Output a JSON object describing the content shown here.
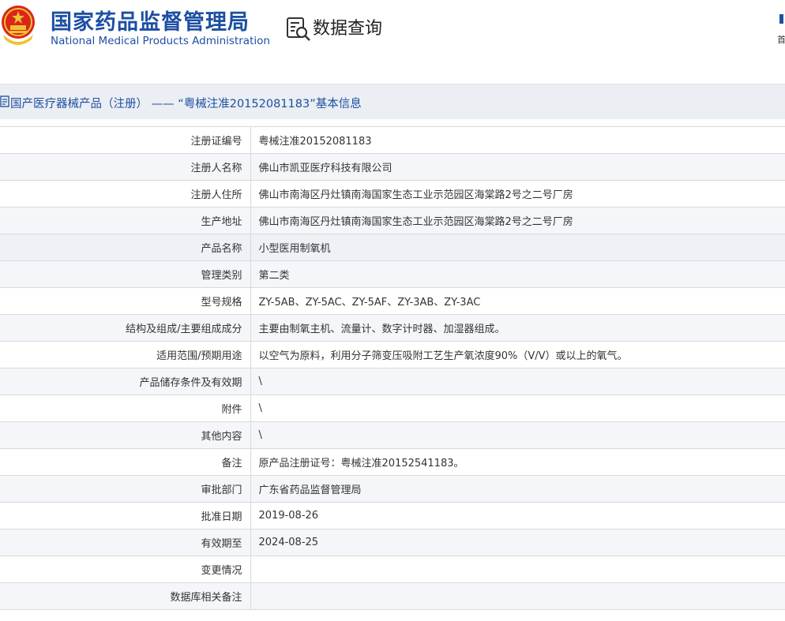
{
  "header": {
    "site_title_cn": "国家药品监督管理局",
    "site_title_en": "National Medical Products Administration",
    "query_title": "数据查询",
    "home_label": "首页",
    "brand_color": "#1d4fa3",
    "emblem_icon": "national-emblem-icon",
    "query_icon": "data-query-icon",
    "home_icon": "home-icon"
  },
  "section": {
    "title": "国产医疗器械产品（注册） —— “粤械注准20152081183”基本信息",
    "icon": "document-icon"
  },
  "table": {
    "rows": [
      {
        "label": "注册证编号",
        "value": "粤械注准20152081183"
      },
      {
        "label": "注册人名称",
        "value": "佛山市凯亚医疗科技有限公司"
      },
      {
        "label": "注册人住所",
        "value": "佛山市南海区丹灶镇南海国家生态工业示范园区海棠路2号之二号厂房"
      },
      {
        "label": "生产地址",
        "value": "佛山市南海区丹灶镇南海国家生态工业示范园区海棠路2号之二号厂房"
      },
      {
        "label": "产品名称",
        "value": "小型医用制氧机"
      },
      {
        "label": "管理类别",
        "value": "第二类"
      },
      {
        "label": "型号规格",
        "value": "ZY-5AB、ZY-5AC、ZY-5AF、ZY-3AB、ZY-3AC"
      },
      {
        "label": "结构及组成/主要组成成分",
        "value": "主要由制氧主机、流量计、数字计时器、加湿器组成。"
      },
      {
        "label": "适用范围/预期用途",
        "value": "以空气为原料，利用分子筛变压吸附工艺生产氧浓度90%（V/V）或以上的氧气。"
      },
      {
        "label": "产品储存条件及有效期",
        "value": "\\"
      },
      {
        "label": "附件",
        "value": "\\"
      },
      {
        "label": "其他内容",
        "value": "\\"
      },
      {
        "label": "备注",
        "value": "原产品注册证号：粤械注准20152541183。"
      },
      {
        "label": "审批部门",
        "value": "广东省药品监督管理局"
      },
      {
        "label": "批准日期",
        "value": "2019-08-26"
      },
      {
        "label": "有效期至",
        "value": "2024-08-25"
      },
      {
        "label": "变更情况",
        "value": ""
      },
      {
        "label": "数据库相关备注",
        "value": ""
      }
    ]
  }
}
